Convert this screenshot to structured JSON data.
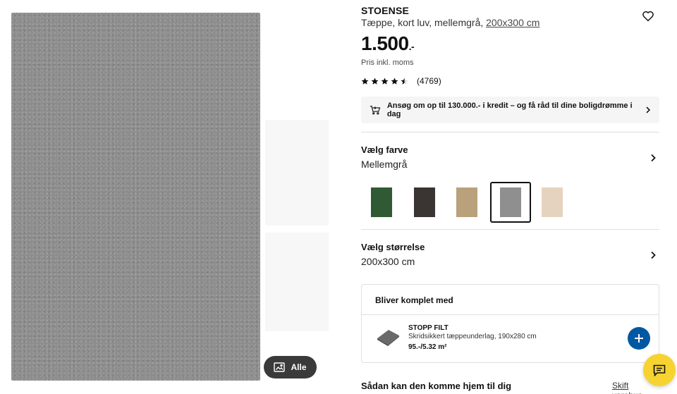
{
  "gallery": {
    "all_label": "Alle",
    "icon": "gallery-icon"
  },
  "product": {
    "name": "STOENSE",
    "description_prefix": "Tæppe, kort luv, mellemgrå, ",
    "size_link": "200x300 cm",
    "price_main": "1.500",
    "price_suffix": ".-",
    "price_note": "Pris inkl. moms",
    "rating": 4.5,
    "rating_max": 5,
    "review_count": "(4769)",
    "favorite_icon": "heart-icon"
  },
  "credit_banner": {
    "text": "Ansøg om op til 130.000.- i kredit – og få råd til dine boligdrømme i dag",
    "icon": "shopping-cart-icon"
  },
  "color_section": {
    "label": "Vælg farve",
    "value": "Mellemgrå",
    "swatches": [
      {
        "name": "green",
        "color": "#2f5a33",
        "selected": false
      },
      {
        "name": "dark-brown",
        "color": "#3a3432",
        "selected": false
      },
      {
        "name": "beige",
        "color": "#b9a17c",
        "selected": false
      },
      {
        "name": "medium-grey",
        "color": "#8f8f8f",
        "selected": true
      },
      {
        "name": "light-beige",
        "color": "#e6d3bf",
        "selected": false
      }
    ]
  },
  "size_section": {
    "label": "Vælg størrelse",
    "value": "200x300 cm"
  },
  "bundle": {
    "title": "Bliver komplet med",
    "item_name": "STOPP FILT",
    "item_desc": "Skridsikkert tæppeunderlag, 190x280 cm",
    "item_price": "95.-/5.32 m²"
  },
  "delivery": {
    "heading": "Sådan kan den komme hjem til dig",
    "store_link": "Skift varehus"
  },
  "colors": {
    "accent_blue": "#0058a3",
    "chat_yellow": "#f7d332",
    "dark_pill": "#3a3a3a"
  }
}
